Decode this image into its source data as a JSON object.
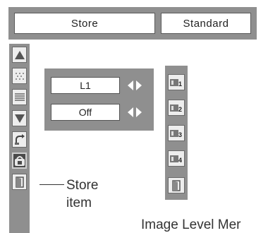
{
  "header": {
    "mode_label": "Store",
    "value_label": "Standard"
  },
  "left_toolbar": {
    "items": [
      {
        "icon": "up-triangle-icon"
      },
      {
        "icon": "dots-pattern-icon"
      },
      {
        "icon": "lines-pattern-icon"
      },
      {
        "icon": "down-triangle-icon"
      },
      {
        "icon": "reset-icon"
      },
      {
        "icon": "store-icon",
        "selected": true
      },
      {
        "icon": "exit-door-icon"
      }
    ]
  },
  "middle_panel": {
    "slot_value": "L1",
    "state_value": "Off"
  },
  "right_toolbar": {
    "items": [
      {
        "icon": "level-1-icon",
        "digit": "1"
      },
      {
        "icon": "level-2-icon",
        "digit": "2"
      },
      {
        "icon": "level-3-icon",
        "digit": "3"
      },
      {
        "icon": "level-4-icon",
        "digit": "4"
      },
      {
        "icon": "exit-door-icon"
      }
    ]
  },
  "callout": {
    "line1": "Store",
    "line2": "item"
  },
  "caption": "Image Level Mer",
  "colors": {
    "panel": "#8f8f8f",
    "button_face": "#ededed",
    "selected_button": "#4a4a4a"
  }
}
